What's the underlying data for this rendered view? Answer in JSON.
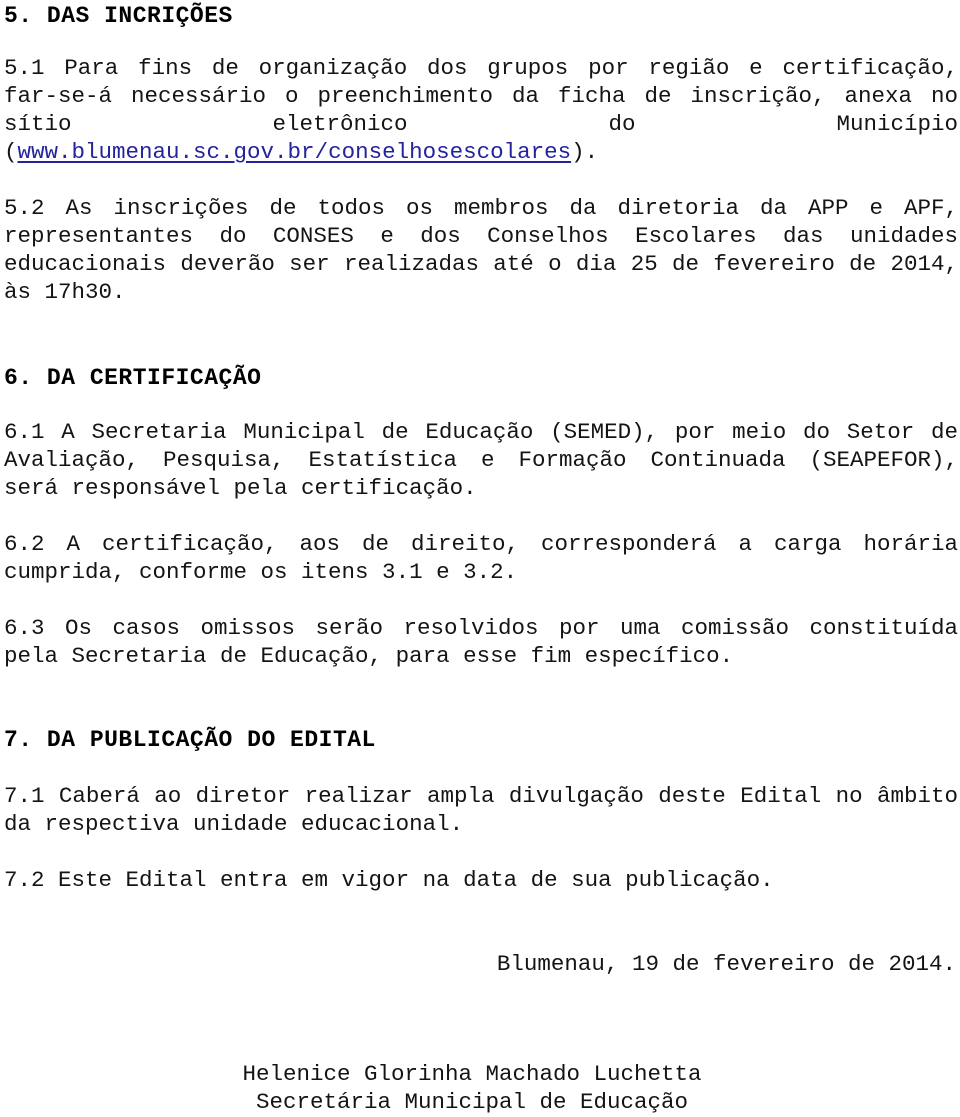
{
  "document": {
    "language": "pt-BR",
    "background_color": "#ffffff",
    "text_color": "#141414",
    "link_color": "#23239c"
  },
  "sections": {
    "inscricoes": {
      "heading": "5. DAS INCRIÇÕES",
      "item_5_1_before_link": "5.1 Para fins de organização dos grupos por região e certificação, far-se-á necessário o preenchimento da ficha de inscrição, anexa no sítio eletrônico do Município (",
      "item_5_1_link": "www.blumenau.sc.gov.br/conselhosescolares",
      "item_5_1_after_link": ").",
      "item_5_2": "5.2 As inscrições de todos os membros da diretoria da APP e APF, representantes do CONSES e dos Conselhos Escolares das unidades educacionais deverão ser realizadas até o dia 25 de fevereiro de 2014, às 17h30."
    },
    "certificacao": {
      "heading": "6. DA CERTIFICAÇÃO",
      "item_6_1": "6.1 A Secretaria Municipal de Educação (SEMED), por meio do Setor de Avaliação, Pesquisa, Estatística e Formação Continuada (SEAPEFOR), será responsável pela certificação.",
      "item_6_2": "6.2 A certificação, aos de direito, corresponderá a carga horária cumprida, conforme os itens 3.1 e 3.2.",
      "item_6_3": "6.3 Os casos omissos serão resolvidos por uma comissão constituída pela Secretaria de Educação, para esse fim específico."
    },
    "publicacao": {
      "heading": "7. DA PUBLICAÇÃO DO EDITAL",
      "item_7_1": "7.1 Caberá ao diretor realizar ampla divulgação deste Edital no âmbito da respectiva unidade educacional.",
      "item_7_2": "7.2 Este Edital entra em vigor na data de sua publicação."
    }
  },
  "closing": {
    "place_and_date": "Blumenau, 19 de fevereiro de 2014.",
    "signatory_name": "Helenice Glorinha Machado Luchetta",
    "signatory_title": "Secretária Municipal de Educação"
  }
}
